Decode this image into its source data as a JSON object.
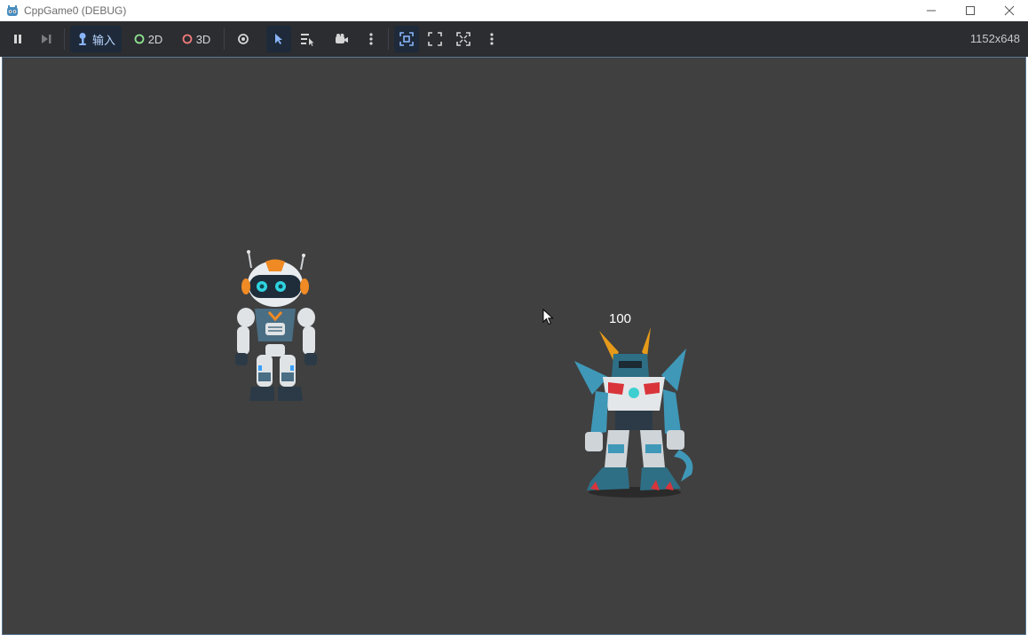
{
  "window": {
    "title": "CppGame0 (DEBUG)"
  },
  "toolbar": {
    "input_label": "输入",
    "mode_2d_label": "2D",
    "mode_3d_label": "3D",
    "resolution": "1152x648"
  },
  "game": {
    "enemy_hp": "100"
  },
  "colors": {
    "toolbar_bg": "#2b2d31",
    "viewport_bg": "#404040",
    "accent": "#4a90e2",
    "mode_2d": "#8fe28f",
    "mode_3d": "#f07a7a"
  },
  "icons": {
    "app": "godot-logo-icon",
    "pause": "pause-icon",
    "step": "step-forward-icon",
    "input": "joystick-icon",
    "visibility": "eye-icon",
    "select": "arrow-cursor-icon",
    "list_select": "list-select-icon",
    "camera": "camera-icon",
    "menu": "vertical-dots-icon"
  }
}
